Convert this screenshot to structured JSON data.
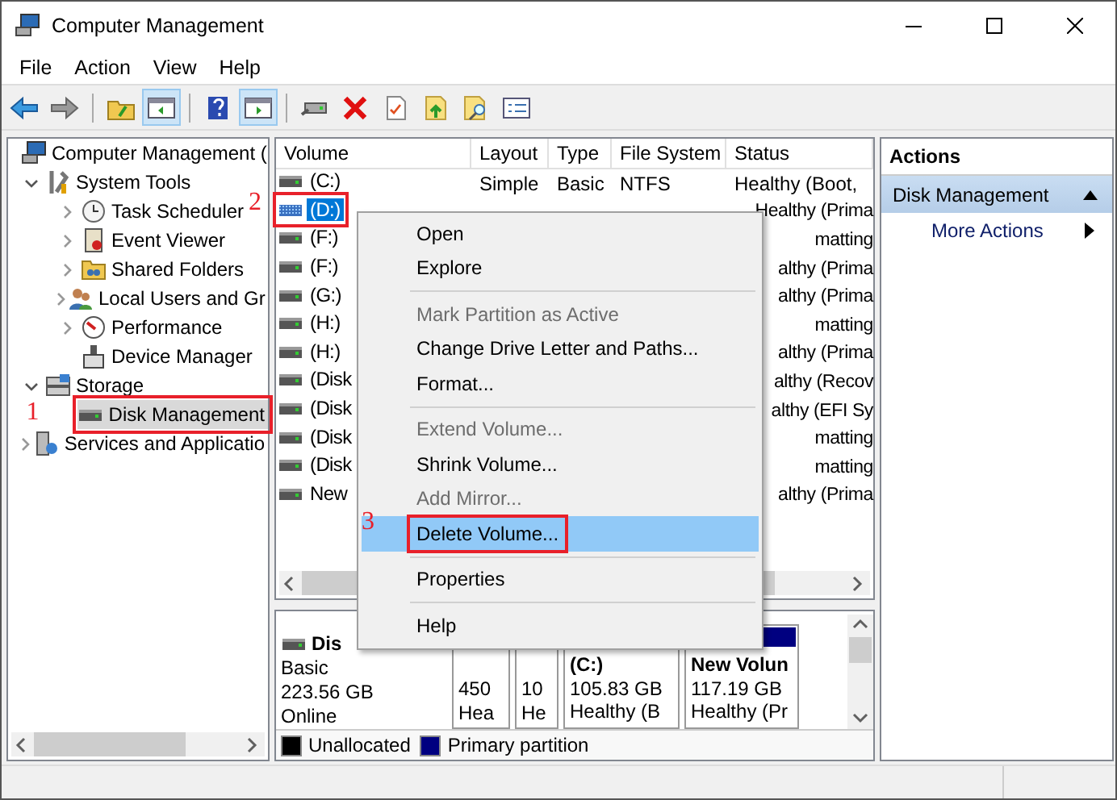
{
  "window": {
    "title": "Computer Management"
  },
  "menu_bar": [
    "File",
    "Action",
    "View",
    "Help"
  ],
  "toolbar": [
    {
      "pressed": false
    },
    {
      "pressed": false
    },
    {
      "pressed": false
    },
    {
      "pressed": true
    },
    {
      "pressed": false
    },
    {
      "pressed": true
    },
    {
      "pressed": false
    },
    {
      "pressed": false
    },
    {
      "pressed": false
    },
    {
      "pressed": false
    },
    {
      "pressed": false
    },
    {
      "pressed": false
    }
  ],
  "tree": [
    {
      "label": "Computer Management (",
      "selected": false,
      "children": [
        {
          "label": "System Tools",
          "expanded": true,
          "selected": false,
          "children": [
            {
              "label": "Task Scheduler",
              "expanded": false,
              "selected": false
            },
            {
              "label": "Event Viewer",
              "expanded": false,
              "selected": false
            },
            {
              "label": "Shared Folders",
              "expanded": false,
              "selected": false
            },
            {
              "label": "Local Users and Gr",
              "expanded": false,
              "selected": false
            },
            {
              "label": "Performance",
              "expanded": false,
              "selected": false
            },
            {
              "label": "Device Manager",
              "selected": false
            }
          ]
        },
        {
          "label": "Storage",
          "expanded": true,
          "selected": false,
          "children": [
            {
              "label": "Disk Management",
              "selected": true,
              "callout": "1"
            }
          ]
        },
        {
          "label": "Services and Applicatio",
          "expanded": false,
          "selected": false
        }
      ]
    }
  ],
  "table": {
    "columns": [
      "Volume",
      "Layout",
      "Type",
      "File System",
      "Status"
    ],
    "rows": [
      {
        "volume": "(C:)",
        "layout": "Simple",
        "type": "Basic",
        "file_system": "NTFS",
        "status": "Healthy (Boot,",
        "selected": false
      },
      {
        "volume": "(D:)",
        "status": "Healthy (Prima",
        "selected": true,
        "callout": "2"
      },
      {
        "volume": "(F:)",
        "status": "matting",
        "selected": false
      },
      {
        "volume": "(F:)",
        "status": "althy (Prima",
        "selected": false
      },
      {
        "volume": "(G:)",
        "status": "althy (Prima",
        "selected": false
      },
      {
        "volume": "(H:)",
        "status": "matting",
        "selected": false
      },
      {
        "volume": "(H:)",
        "status": "althy (Prima",
        "selected": false
      },
      {
        "volume": "(Disk",
        "status": "althy (Recov",
        "selected": false
      },
      {
        "volume": "(Disk",
        "status": "althy (EFI Sy",
        "selected": false
      },
      {
        "volume": "(Disk",
        "status": "matting",
        "selected": false
      },
      {
        "volume": "(Disk",
        "status": "matting",
        "selected": false
      },
      {
        "volume": "New",
        "status": "althy (Prima",
        "selected": false
      }
    ]
  },
  "context_menu": [
    {
      "kind": "item",
      "label": "Open",
      "disabled": false,
      "selected": false
    },
    {
      "kind": "item",
      "label": "Explore",
      "disabled": false,
      "selected": false
    },
    {
      "kind": "separator"
    },
    {
      "kind": "item",
      "label": "Mark Partition as Active",
      "disabled": true,
      "selected": false
    },
    {
      "kind": "item",
      "label": "Change Drive Letter and Paths...",
      "disabled": false,
      "selected": false
    },
    {
      "kind": "item",
      "label": "Format...",
      "disabled": false,
      "selected": false
    },
    {
      "kind": "separator"
    },
    {
      "kind": "item",
      "label": "Extend Volume...",
      "disabled": true,
      "selected": false
    },
    {
      "kind": "item",
      "label": "Shrink Volume...",
      "disabled": false,
      "selected": false
    },
    {
      "kind": "item",
      "label": "Add Mirror...",
      "disabled": true,
      "selected": false
    },
    {
      "kind": "item",
      "label": "Delete Volume...",
      "disabled": false,
      "selected": true,
      "callout": "3"
    },
    {
      "kind": "separator"
    },
    {
      "kind": "item",
      "label": "Properties",
      "disabled": false,
      "selected": false
    },
    {
      "kind": "separator"
    },
    {
      "kind": "item",
      "label": "Help",
      "disabled": false,
      "selected": false
    }
  ],
  "disk_view": {
    "disk": {
      "name": "Dis",
      "type": "Basic",
      "size": "223.56 GB",
      "status": "Online"
    },
    "partitions": [
      {
        "lines": [
          "450",
          "Hea"
        ]
      },
      {
        "lines": [
          "10",
          "He"
        ]
      },
      {
        "title": "(C:)",
        "lines": [
          "105.83 GB",
          "Healthy (B"
        ]
      },
      {
        "color": "#000080",
        "title": "New Volun",
        "lines": [
          "117.19 GB",
          "Healthy (Pr"
        ]
      }
    ],
    "legend": [
      {
        "label": "Unallocated",
        "color": "#000000"
      },
      {
        "label": "Primary partition",
        "color": "#000080"
      }
    ]
  },
  "actions": {
    "header": "Actions",
    "sections": [
      {
        "title": "Disk Management",
        "expanded": true,
        "items": [
          "More Actions"
        ]
      }
    ]
  }
}
